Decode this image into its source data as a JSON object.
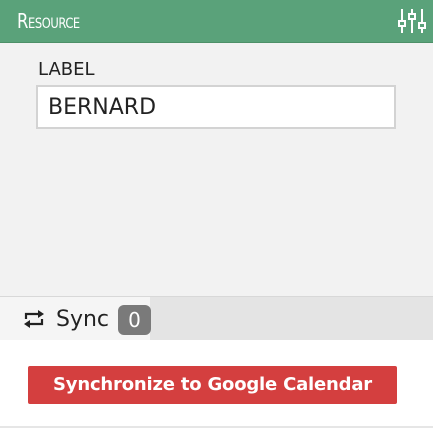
{
  "header": {
    "title": "Resource",
    "settings_icon": "sliders-icon",
    "background_color": "#5aa27a"
  },
  "form": {
    "label_field": {
      "label": "LABEL",
      "value": "BERNARD"
    }
  },
  "sync_tab": {
    "icon": "sync-icon",
    "label": "Sync",
    "count": "0"
  },
  "actions": {
    "sync_button_label": "Synchronize to Google Calendar",
    "sync_button_color": "#d43f3f"
  }
}
